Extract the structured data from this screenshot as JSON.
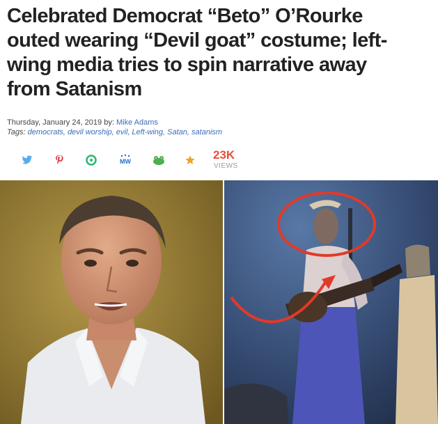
{
  "headline": {
    "lines": [
      "Celebrated Democrat “Beto” O’Rourke",
      "outed wearing “Devil goat” costume; left-",
      "wing media tries to spin narrative away",
      "from Satanism"
    ]
  },
  "meta": {
    "date": "Thursday, January 24, 2019",
    "by_label": "by:",
    "author": "Mike Adams",
    "tags_label": "Tags:",
    "tags": [
      "democrats,",
      "devil worship,",
      "evil,",
      "Left-wing,",
      "Satan,",
      "satanism"
    ]
  },
  "share": {
    "icons": [
      "twitter-icon",
      "pinterest-icon",
      "circle-share-icon",
      "mewe-icon",
      "frog-icon",
      "star-icon"
    ],
    "mewe_text": "MW",
    "views_count": "23K",
    "views_label": "VIEWS"
  },
  "colors": {
    "headline": "#222222",
    "link": "#3b6cb7",
    "views": "#e94e37",
    "annotation": "#e03a2a"
  }
}
